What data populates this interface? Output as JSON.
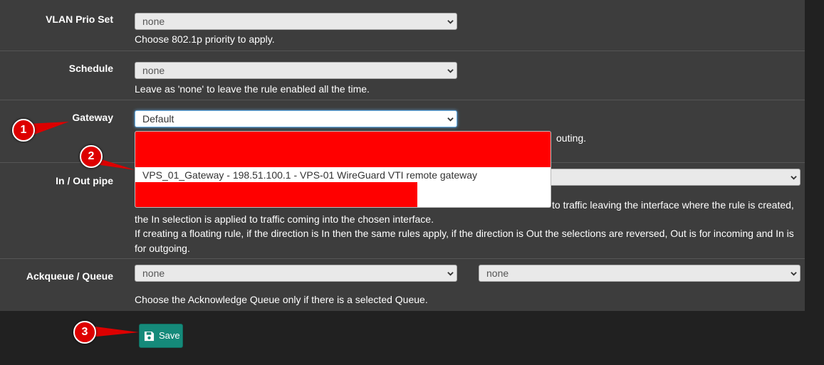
{
  "vlan": {
    "label": "VLAN Prio Set",
    "value": "none",
    "help": "Choose 802.1p priority to apply."
  },
  "schedule": {
    "label": "Schedule",
    "value": "none",
    "help": "Leave as 'none' to leave the rule enabled all the time."
  },
  "gateway": {
    "label": "Gateway",
    "value": "Default",
    "help_fragment": "outing.",
    "options_visible": "VPS_01_Gateway - 198.51.100.1 - VPS-01 WireGuard VTI remote gateway"
  },
  "pipe": {
    "label": "In / Out pipe",
    "help_line1": "to traffic leaving the interface where the rule is created,",
    "help_line2": "the In selection is applied to traffic coming into the chosen interface.",
    "help_line3": "If creating a floating rule, if the direction is In then the same rules apply, if the direction is Out the selections are reversed, Out is for incoming and In is",
    "help_line4": "for outgoing."
  },
  "ackqueue": {
    "label": "Ackqueue / Queue",
    "ack_value": "none",
    "queue_value": "none",
    "help": "Choose the Acknowledge Queue only if there is a selected Queue."
  },
  "save": {
    "label": "Save",
    "icon": "floppy-disk-icon"
  },
  "callouts": {
    "one": "1",
    "two": "2",
    "three": "3"
  },
  "colors": {
    "panel_bg": "#3d3d3d",
    "page_bg": "#212121",
    "save_button": "#158a7a",
    "callout_red": "#dd0000",
    "redaction": "#ff0000"
  }
}
